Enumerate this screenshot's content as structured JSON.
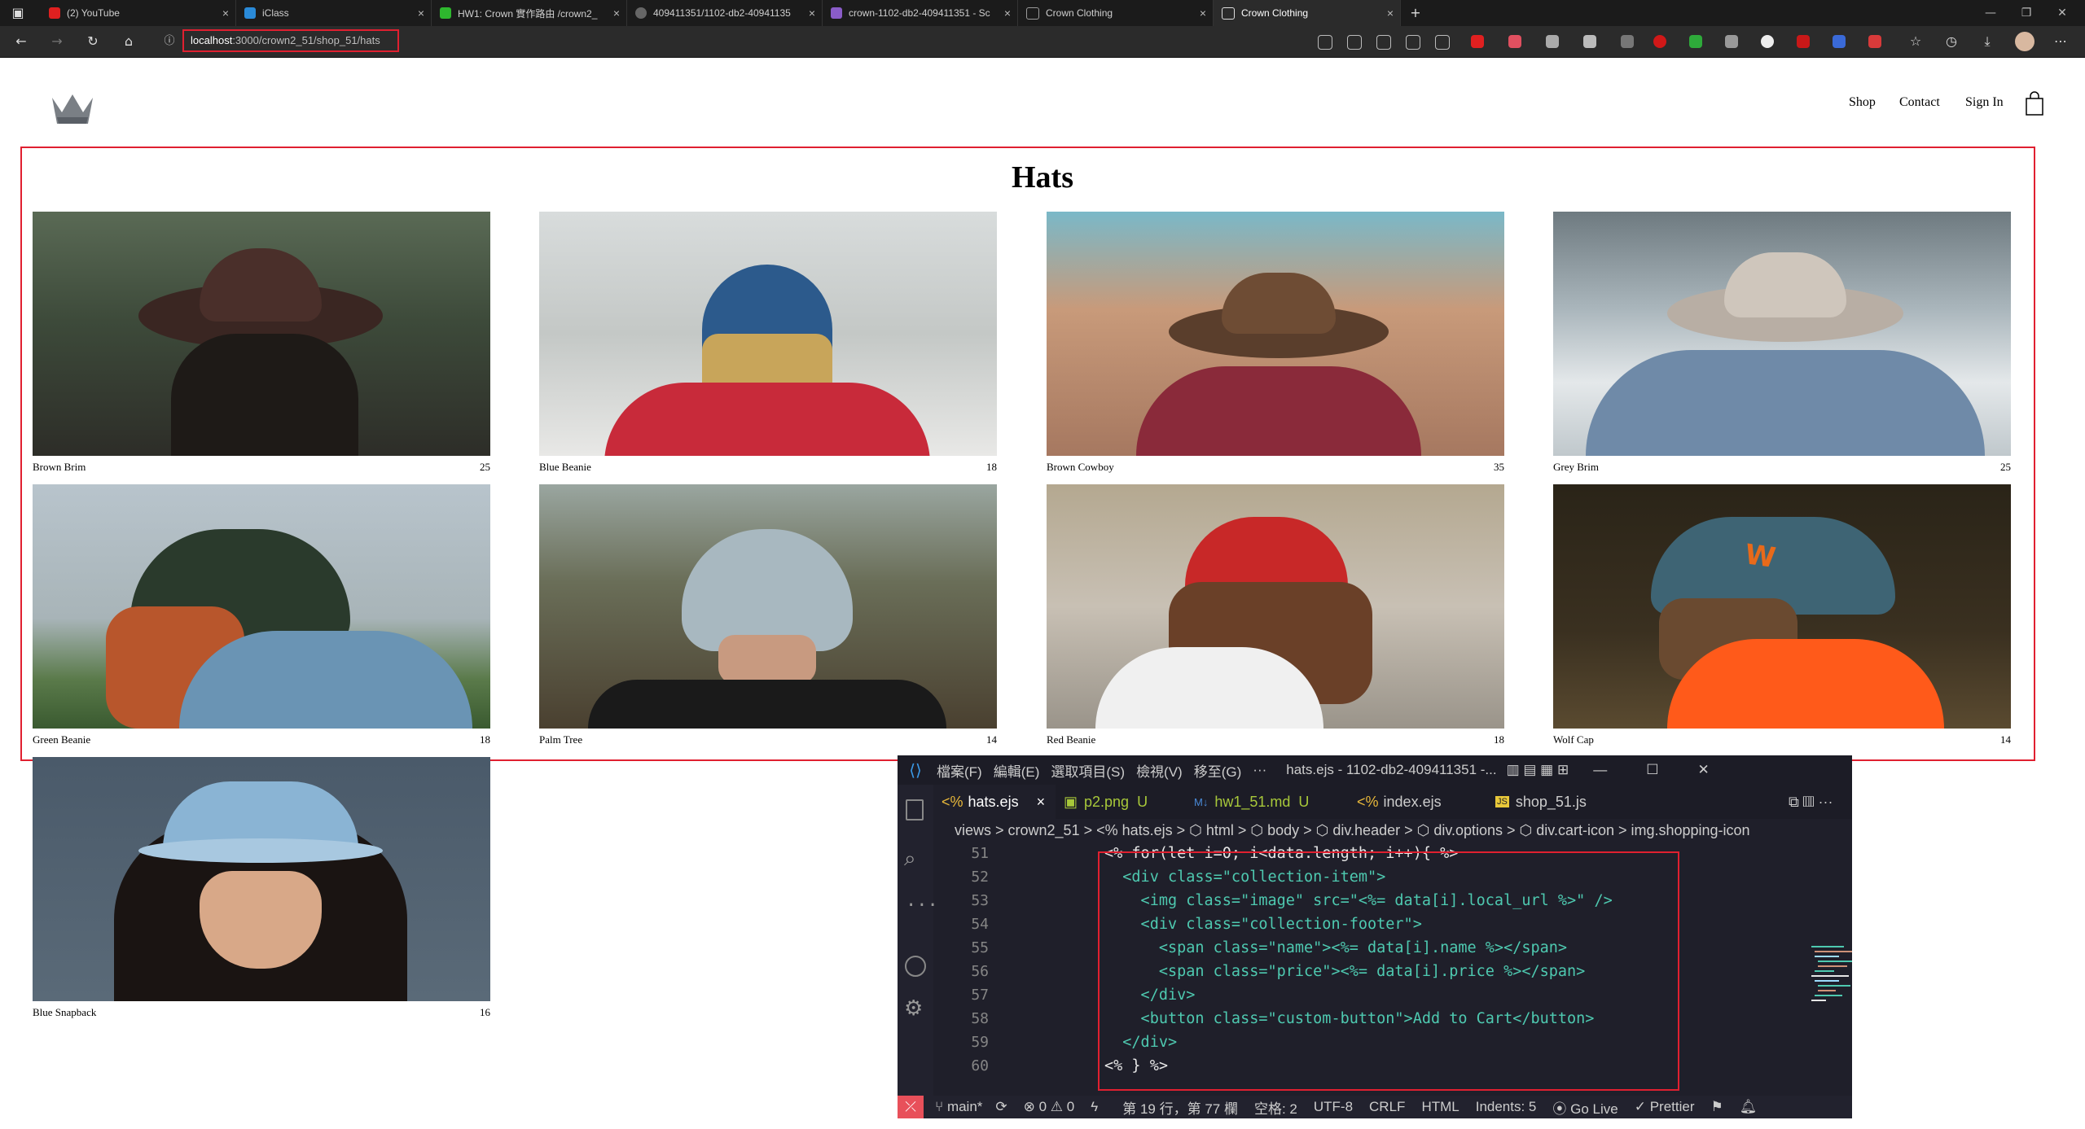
{
  "browser": {
    "tabs": [
      {
        "label": "(2) YouTube",
        "color": "#e02020"
      },
      {
        "label": "iClass",
        "color": "#2a8ad8"
      },
      {
        "label": "HW1: Crown 實作路由 /crown2_",
        "color": "#2eb82e"
      },
      {
        "label": "409411351/1102-db2-40941135",
        "color": "#666666"
      },
      {
        "label": "crown-1102-db2-409411351 - Sc",
        "color": "#8a5cc8"
      },
      {
        "label": "Crown Clothing",
        "color": "#9a9a9a"
      },
      {
        "label": "Crown Clothing",
        "color": "#9a9a9a"
      }
    ],
    "url_host": "localhost",
    "url_rest": ":3000/crown2_51/shop_51/hats"
  },
  "site": {
    "nav": [
      "Shop",
      "Contact",
      "Sign In"
    ]
  },
  "collection": {
    "title": "Hats",
    "items": [
      {
        "name": "Brown Brim",
        "price": "25"
      },
      {
        "name": "Blue Beanie",
        "price": "18"
      },
      {
        "name": "Brown Cowboy",
        "price": "35"
      },
      {
        "name": "Grey Brim",
        "price": "25"
      },
      {
        "name": "Green Beanie",
        "price": "18"
      },
      {
        "name": "Palm Tree",
        "price": "14"
      },
      {
        "name": "Red Beanie",
        "price": "18"
      },
      {
        "name": "Wolf Cap",
        "price": "14"
      },
      {
        "name": "Blue Snapback",
        "price": "16"
      }
    ]
  },
  "vscode": {
    "menu": [
      "檔案(F)",
      "編輯(E)",
      "選取項目(S)",
      "檢視(V)",
      "移至(G)",
      "···"
    ],
    "window_title": "hats.ejs - 1102-db2-409411351 -...",
    "tabs": [
      {
        "label": "hats.ejs",
        "status": "×"
      },
      {
        "label": "p2.png",
        "status": "U"
      },
      {
        "label": "hw1_51.md",
        "status": "U"
      },
      {
        "label": "index.ejs",
        "status": ""
      },
      {
        "label": "shop_51.js",
        "status": ""
      }
    ],
    "breadcrumbs": "views > crown2_51 > <% hats.ejs > ⬡ html > ⬡ body > ⬡ div.header > ⬡ div.options > ⬡ div.cart-icon > img.shopping-icon",
    "line_numbers": [
      "51",
      "52",
      "53",
      "54",
      "55",
      "56",
      "57",
      "58",
      "59",
      "60"
    ],
    "code_lines": [
      "<% for(let i=0; i<data.length; i++){ %>",
      "  <div class=\"collection-item\">",
      "    <img class=\"image\" src=\"<%= data[i].local_url %>\" />",
      "    <div class=\"collection-footer\">",
      "      <span class=\"name\"><%= data[i].name %></span>",
      "      <span class=\"price\"><%= data[i].price %></span>",
      "    </div>",
      "    <button class=\"custom-button\">Add to Cart</button>",
      "  </div>",
      "<% } %>"
    ],
    "status": {
      "branch": "main*",
      "problems": "⊗ 0 ⚠ 0",
      "position": "第 19 行，第 77 欄",
      "spaces": "空格: 2",
      "encoding": "UTF-8",
      "eol": "CRLF",
      "language": "HTML",
      "indents": "Indents: 5",
      "golive": "Go Live",
      "prettier": "Prettier"
    }
  }
}
